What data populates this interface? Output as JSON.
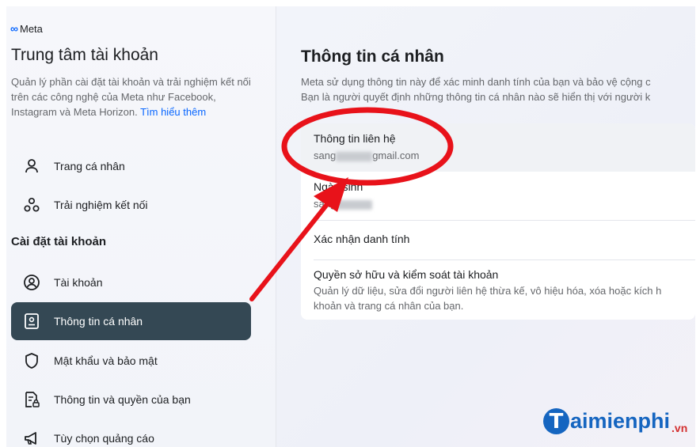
{
  "sidebar": {
    "brand_logo_symbol": "∞",
    "brand_name": "Meta",
    "title": "Trung tâm tài khoản",
    "description": "Quản lý phần cài đặt tài khoản và trải nghiệm kết nối trên các công nghệ của Meta như Facebook, Instagram và Meta Horizon.",
    "learn_more": "Tìm hiểu thêm",
    "items_top": [
      {
        "label": "Trang cá nhân",
        "icon": "person-icon"
      },
      {
        "label": "Trải nghiệm kết nối",
        "icon": "connected-experiences-icon"
      }
    ],
    "section_heading": "Cài đặt tài khoản",
    "items_settings": [
      {
        "label": "Tài khoản",
        "icon": "account-circle-icon"
      },
      {
        "label": "Thông tin cá nhân",
        "icon": "id-card-icon",
        "active": true
      },
      {
        "label": "Mật khẩu và bảo mật",
        "icon": "shield-icon"
      },
      {
        "label": "Thông tin và quyền của bạn",
        "icon": "document-lock-icon"
      },
      {
        "label": "Tùy chọn quảng cáo",
        "icon": "megaphone-icon"
      }
    ]
  },
  "main": {
    "title": "Thông tin cá nhân",
    "description_line1": "Meta sử dụng thông tin này để xác minh danh tính của bạn và bảo vệ cộng c",
    "description_line2": "Bạn là người quyết định những thông tin cá nhân nào sẽ hiển thị với người k",
    "rows": [
      {
        "title": "Thông tin liên hệ",
        "value_prefix": "sang",
        "value_suffix": "gmail.com"
      },
      {
        "title": "Ngày sinh",
        "value_prefix": "sang"
      },
      {
        "title": "Xác nhận danh tính"
      },
      {
        "title": "Quyền sở hữu và kiểm soát tài khoản",
        "desc_line1": "Quản lý dữ liệu, sửa đổi người liên hệ thừa kế, vô hiệu hóa, xóa hoặc kích h",
        "desc_line2": "khoản và trang cá nhân của bạn."
      }
    ]
  },
  "watermark": {
    "brand_t": "T",
    "brand_rest": "aimienphi",
    "brand_suffix": ".vn"
  },
  "colors": {
    "accent": "#0866ff",
    "active_nav": "#344854",
    "annotation": "#e8121a",
    "watermark_blue": "#1565c0"
  }
}
